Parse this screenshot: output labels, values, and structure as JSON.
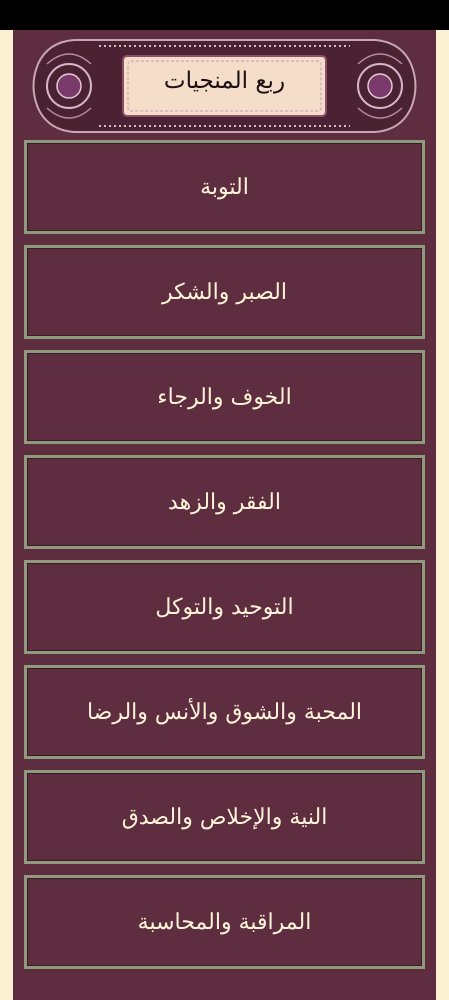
{
  "header": {
    "title": "ربع المنجيات"
  },
  "items": [
    {
      "label": "التوبة"
    },
    {
      "label": "الصبر والشكر"
    },
    {
      "label": "الخوف والرجاء"
    },
    {
      "label": "الفقر والزهد"
    },
    {
      "label": "التوحيد والتوكل"
    },
    {
      "label": "المحبة والشوق والأنس والرضا"
    },
    {
      "label": "النية والإخلاص والصدق"
    },
    {
      "label": "المراقبة والمحاسبة"
    }
  ],
  "colors": {
    "background": "#fbf0d2",
    "panel": "#5e2d3f",
    "item_border": "#8f9a7c",
    "text": "#fff3d8"
  }
}
